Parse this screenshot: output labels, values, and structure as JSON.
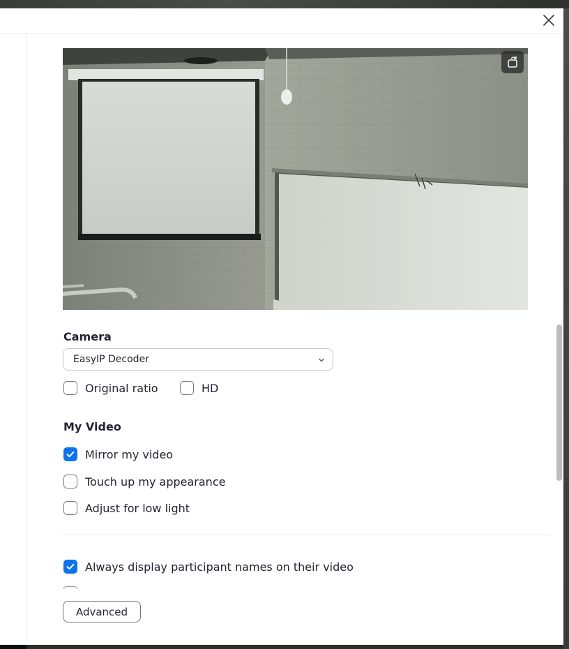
{
  "dialog": {
    "close_icon": "close-icon",
    "rotate_icon": "rotate-camera-icon"
  },
  "camera": {
    "title": "Camera",
    "selected_device": "EasyIP Decoder",
    "original_ratio": {
      "label": "Original ratio",
      "checked": false
    },
    "hd": {
      "label": "HD",
      "checked": false
    }
  },
  "my_video": {
    "title": "My Video",
    "options": [
      {
        "label": "Mirror my video",
        "checked": true
      },
      {
        "label": "Touch up my appearance",
        "checked": false
      },
      {
        "label": "Adjust for low light",
        "checked": false
      }
    ]
  },
  "participants": {
    "always_display_names": {
      "label": "Always display participant names on their video",
      "checked": true
    }
  },
  "footer": {
    "advanced_label": "Advanced"
  },
  "colors": {
    "accent": "#0e72ed",
    "text": "#232333"
  }
}
